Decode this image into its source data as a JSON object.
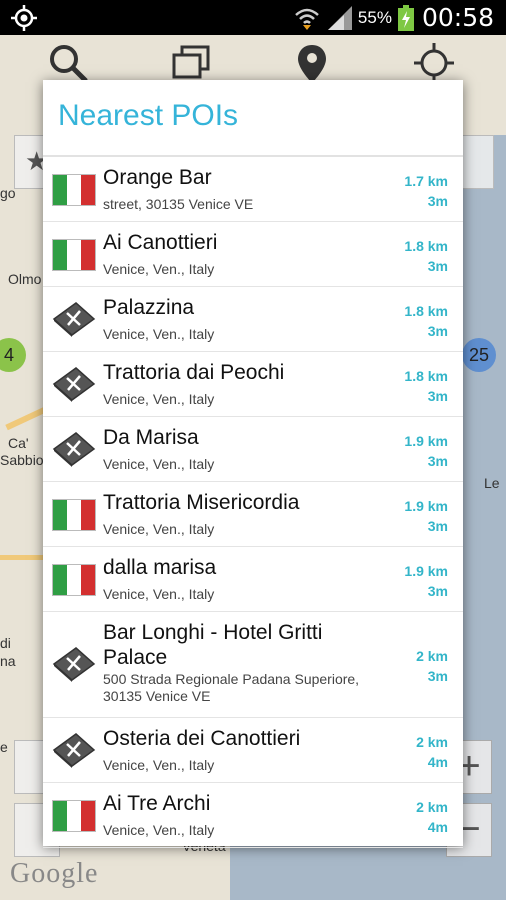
{
  "status_bar": {
    "battery_percent": "55%",
    "time": "00:58"
  },
  "map": {
    "labels": [
      "Olmo",
      "Ca'",
      "Sabbion",
      "Le",
      "go",
      "di",
      "na",
      "e",
      "Veneta"
    ],
    "clusters": [
      "4",
      "25"
    ],
    "zoom_in_label": "+",
    "zoom_out_label": "−",
    "attribution": "Google"
  },
  "dialog": {
    "title": "Nearest POIs",
    "items": [
      {
        "name": "Orange Bar",
        "address": "street, 30135 Venice VE",
        "distance": "1.7 km",
        "time": "3m",
        "icon": "italy-flag-icon"
      },
      {
        "name": "Ai Canottieri",
        "address": "Venice, Ven., Italy",
        "distance": "1.8 km",
        "time": "3m",
        "icon": "italy-flag-icon"
      },
      {
        "name": "Palazzina",
        "address": "Venice, Ven., Italy",
        "distance": "1.8 km",
        "time": "3m",
        "icon": "restaurant-icon"
      },
      {
        "name": "Trattoria dai Peochi",
        "address": "Venice, Ven., Italy",
        "distance": "1.8 km",
        "time": "3m",
        "icon": "restaurant-icon"
      },
      {
        "name": "Da Marisa",
        "address": "Venice, Ven., Italy",
        "distance": "1.9 km",
        "time": "3m",
        "icon": "restaurant-icon"
      },
      {
        "name": "Trattoria Misericordia",
        "address": "Venice, Ven., Italy",
        "distance": "1.9 km",
        "time": "3m",
        "icon": "italy-flag-icon"
      },
      {
        "name": "dalla marisa",
        "address": "Venice, Ven., Italy",
        "distance": "1.9 km",
        "time": "3m",
        "icon": "italy-flag-icon"
      },
      {
        "name": "Bar Longhi - Hotel Gritti Palace",
        "address": "500 Strada Regionale Padana Superiore, 30135 Venice VE",
        "distance": "2 km",
        "time": "3m",
        "icon": "restaurant-icon"
      },
      {
        "name": "Osteria dei Canottieri",
        "address": "Venice, Ven., Italy",
        "distance": "2 km",
        "time": "4m",
        "icon": "restaurant-icon"
      },
      {
        "name": "Ai Tre Archi",
        "address": "Venice, Ven., Italy",
        "distance": "2 km",
        "time": "4m",
        "icon": "italy-flag-icon"
      }
    ]
  },
  "colors": {
    "accent": "#35b4d9",
    "distance": "#33b5c9",
    "flag_green": "#2f9e44",
    "flag_white": "#ffffff",
    "flag_red": "#d32f2f"
  }
}
